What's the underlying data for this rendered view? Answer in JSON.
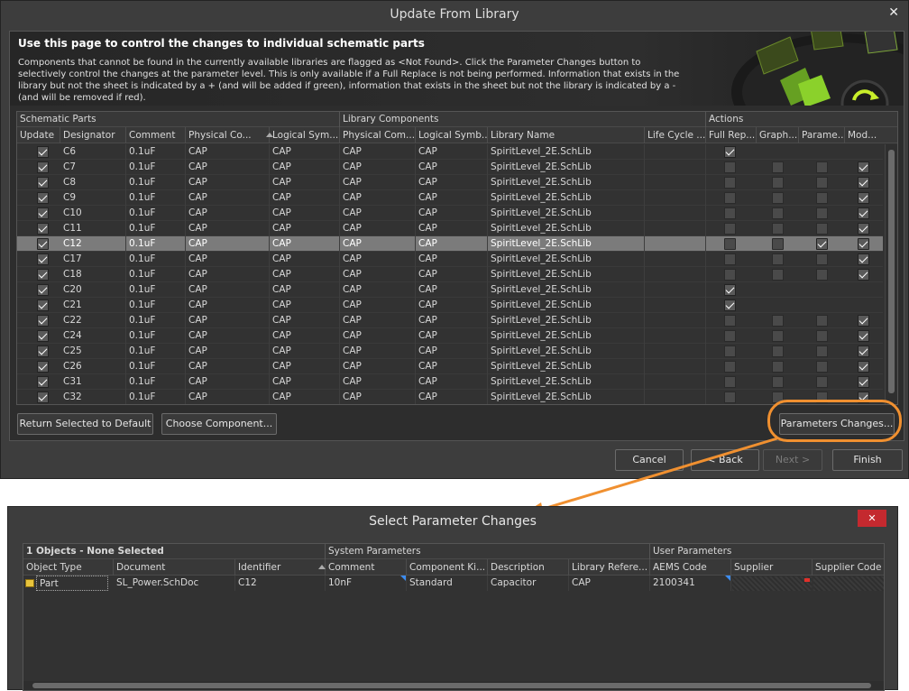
{
  "dialog1": {
    "title": "Update From Library",
    "close_symbol": "✕",
    "header_title": "Use this page to control the changes to individual schematic parts",
    "header_description": "Components that cannot be found in the currently available libraries are flagged as <Not Found>. Click the Parameter Changes button to selectively control the changes at the parameter level. This is only available if a Full Replace is not being performed. Information that exists in the library but not the sheet is indicated by a + (and will be added if green), information that exists in the sheet but not the library is indicated by a - (and will be removed if red).",
    "groups": {
      "schematic_parts": "Schematic Parts",
      "library_components": "Library Components",
      "actions": "Actions"
    },
    "columns": [
      "Update",
      "Designator",
      "Comment",
      "Physical Co...",
      "Logical Sym...",
      "Physical Com...",
      "Logical Symb...",
      "Library Name",
      "Life Cycle ...",
      "Full Rep...",
      "Graph...",
      "Parame...",
      "Mod..."
    ],
    "rows": [
      {
        "designator": "C6",
        "comment": "0.1uF",
        "pc": "CAP",
        "ls": "CAP",
        "lpc": "CAP",
        "lls": "CAP",
        "lib": "SpiritLevel_2E.SchLib",
        "full": true,
        "graph": null,
        "param": null,
        "mod": null,
        "selected": false
      },
      {
        "designator": "C7",
        "comment": "0.1uF",
        "pc": "CAP",
        "ls": "CAP",
        "lpc": "CAP",
        "lls": "CAP",
        "lib": "SpiritLevel_2E.SchLib",
        "full": false,
        "graph": false,
        "param": false,
        "mod": true,
        "selected": false
      },
      {
        "designator": "C8",
        "comment": "0.1uF",
        "pc": "CAP",
        "ls": "CAP",
        "lpc": "CAP",
        "lls": "CAP",
        "lib": "SpiritLevel_2E.SchLib",
        "full": false,
        "graph": false,
        "param": false,
        "mod": true,
        "selected": false
      },
      {
        "designator": "C9",
        "comment": "0.1uF",
        "pc": "CAP",
        "ls": "CAP",
        "lpc": "CAP",
        "lls": "CAP",
        "lib": "SpiritLevel_2E.SchLib",
        "full": false,
        "graph": false,
        "param": false,
        "mod": true,
        "selected": false
      },
      {
        "designator": "C10",
        "comment": "0.1uF",
        "pc": "CAP",
        "ls": "CAP",
        "lpc": "CAP",
        "lls": "CAP",
        "lib": "SpiritLevel_2E.SchLib",
        "full": false,
        "graph": false,
        "param": false,
        "mod": true,
        "selected": false
      },
      {
        "designator": "C11",
        "comment": "0.1uF",
        "pc": "CAP",
        "ls": "CAP",
        "lpc": "CAP",
        "lls": "CAP",
        "lib": "SpiritLevel_2E.SchLib",
        "full": false,
        "graph": false,
        "param": false,
        "mod": true,
        "selected": false
      },
      {
        "designator": "C12",
        "comment": "0.1uF",
        "pc": "CAP",
        "ls": "CAP",
        "lpc": "CAP",
        "lls": "CAP",
        "lib": "SpiritLevel_2E.SchLib",
        "full": false,
        "graph": false,
        "param": true,
        "mod": true,
        "selected": true
      },
      {
        "designator": "C17",
        "comment": "0.1uF",
        "pc": "CAP",
        "ls": "CAP",
        "lpc": "CAP",
        "lls": "CAP",
        "lib": "SpiritLevel_2E.SchLib",
        "full": false,
        "graph": false,
        "param": false,
        "mod": true,
        "selected": false
      },
      {
        "designator": "C18",
        "comment": "0.1uF",
        "pc": "CAP",
        "ls": "CAP",
        "lpc": "CAP",
        "lls": "CAP",
        "lib": "SpiritLevel_2E.SchLib",
        "full": false,
        "graph": false,
        "param": false,
        "mod": true,
        "selected": false
      },
      {
        "designator": "C20",
        "comment": "0.1uF",
        "pc": "CAP",
        "ls": "CAP",
        "lpc": "CAP",
        "lls": "CAP",
        "lib": "SpiritLevel_2E.SchLib",
        "full": true,
        "graph": null,
        "param": null,
        "mod": null,
        "selected": false
      },
      {
        "designator": "C21",
        "comment": "0.1uF",
        "pc": "CAP",
        "ls": "CAP",
        "lpc": "CAP",
        "lls": "CAP",
        "lib": "SpiritLevel_2E.SchLib",
        "full": true,
        "graph": null,
        "param": null,
        "mod": null,
        "selected": false
      },
      {
        "designator": "C22",
        "comment": "0.1uF",
        "pc": "CAP",
        "ls": "CAP",
        "lpc": "CAP",
        "lls": "CAP",
        "lib": "SpiritLevel_2E.SchLib",
        "full": false,
        "graph": false,
        "param": false,
        "mod": true,
        "selected": false
      },
      {
        "designator": "C24",
        "comment": "0.1uF",
        "pc": "CAP",
        "ls": "CAP",
        "lpc": "CAP",
        "lls": "CAP",
        "lib": "SpiritLevel_2E.SchLib",
        "full": false,
        "graph": false,
        "param": false,
        "mod": true,
        "selected": false
      },
      {
        "designator": "C25",
        "comment": "0.1uF",
        "pc": "CAP",
        "ls": "CAP",
        "lpc": "CAP",
        "lls": "CAP",
        "lib": "SpiritLevel_2E.SchLib",
        "full": false,
        "graph": false,
        "param": false,
        "mod": true,
        "selected": false
      },
      {
        "designator": "C26",
        "comment": "0.1uF",
        "pc": "CAP",
        "ls": "CAP",
        "lpc": "CAP",
        "lls": "CAP",
        "lib": "SpiritLevel_2E.SchLib",
        "full": false,
        "graph": false,
        "param": false,
        "mod": true,
        "selected": false
      },
      {
        "designator": "C31",
        "comment": "0.1uF",
        "pc": "CAP",
        "ls": "CAP",
        "lpc": "CAP",
        "lls": "CAP",
        "lib": "SpiritLevel_2E.SchLib",
        "full": false,
        "graph": false,
        "param": false,
        "mod": true,
        "selected": false
      },
      {
        "designator": "C32",
        "comment": "0.1uF",
        "pc": "CAP",
        "ls": "CAP",
        "lpc": "CAP",
        "lls": "CAP",
        "lib": "SpiritLevel_2E.SchLib",
        "full": false,
        "graph": false,
        "param": false,
        "mod": true,
        "selected": false
      }
    ],
    "buttons": {
      "return_default": "Return Selected to Default",
      "choose_component": "Choose Component...",
      "parameters_changes": "Parameters Changes...",
      "cancel": "Cancel",
      "back": "< Back",
      "next": "Next >",
      "finish": "Finish"
    }
  },
  "dialog2": {
    "title": "Select Parameter Changes",
    "close_symbol": "✕",
    "groups": {
      "objects": "1 Objects - None Selected",
      "system": "System Parameters",
      "user": "User Parameters"
    },
    "columns": [
      "Object Type",
      "Document",
      "Identifier",
      "Comment",
      "Component Ki...",
      "Description",
      "Library Refere...",
      "AEMS Code",
      "Supplier",
      "Supplier Code"
    ],
    "row": {
      "object_type": "Part",
      "document": "SL_Power.SchDoc",
      "identifier": "C12",
      "comment": "10nF",
      "component_kind": "Standard",
      "description": "Capacitor",
      "library_reference": "CAP",
      "aems_code": "2100341"
    }
  },
  "colors": {
    "accent_orange": "#f09030",
    "selection_gray": "#7b7b7b",
    "close_red": "#c4292f",
    "modified_blue": "#3c8cf0",
    "removed_red": "#e0302a"
  }
}
